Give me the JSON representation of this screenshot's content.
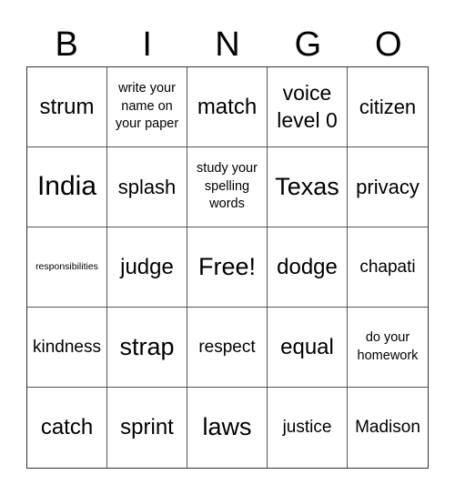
{
  "header": {
    "letters": [
      "B",
      "I",
      "N",
      "G",
      "O"
    ]
  },
  "board": {
    "cells": [
      "strum",
      "write your name on your paper",
      "match",
      "voice level 0",
      "citizen",
      "India",
      "splash",
      "study your spelling words",
      "Texas",
      "privacy",
      "responsibilities",
      "judge",
      "Free!",
      "dodge",
      "chapati",
      "kindness",
      "strap",
      "respect",
      "equal",
      "do your homework",
      "catch",
      "sprint",
      "laws",
      "justice",
      "Madison"
    ],
    "free_space": "Free!"
  }
}
